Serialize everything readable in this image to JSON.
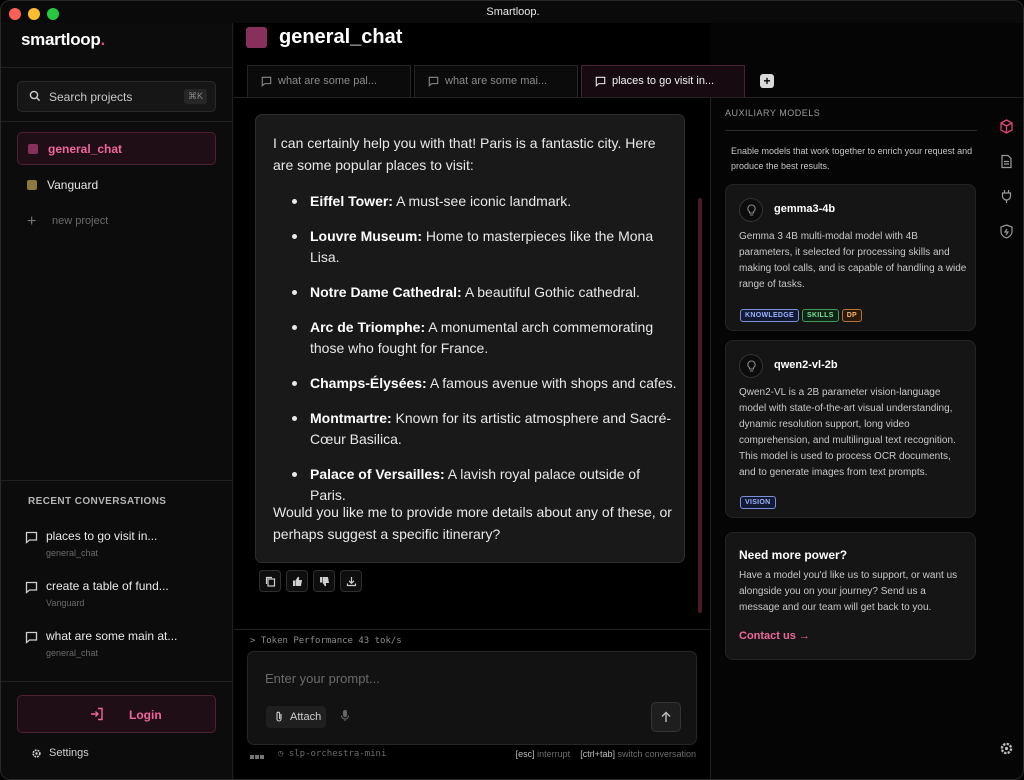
{
  "window": {
    "title": "Smartloop."
  },
  "brand": {
    "name": "smartloop",
    "dot": "."
  },
  "search": {
    "placeholder": "Search projects",
    "shortcut": "⌘K"
  },
  "projects": [
    {
      "label": "general_chat",
      "color": "#86305b",
      "active": true
    },
    {
      "label": "Vanguard",
      "color": "#8a7a3e",
      "active": false
    }
  ],
  "new_project": {
    "label": "new project"
  },
  "recent": {
    "heading": "RECENT CONVERSATIONS",
    "items": [
      {
        "title": "places to go visit in...",
        "project": "general_chat"
      },
      {
        "title": "create a table of fund...",
        "project": "Vanguard"
      },
      {
        "title": "what are some main at...",
        "project": "general_chat"
      }
    ]
  },
  "login": {
    "label": "Login"
  },
  "settings": {
    "label": "Settings"
  },
  "main": {
    "title": "general_chat",
    "tabs": [
      {
        "label": "what are some pal...",
        "active": false
      },
      {
        "label": "what are some mai...",
        "active": false
      },
      {
        "label": "places to go visit in...",
        "active": true
      }
    ]
  },
  "message": {
    "intro": "I can certainly help you with that! Paris is a fantastic city. Here are some popular places to visit:",
    "items": [
      {
        "name": "Eiffel Tower:",
        "desc": " A must-see iconic landmark."
      },
      {
        "name": "Louvre Museum:",
        "desc": " Home to masterpieces like the Mona Lisa."
      },
      {
        "name": "Notre Dame Cathedral:",
        "desc": " A beautiful Gothic cathedral."
      },
      {
        "name": "Arc de Triomphe:",
        "desc": " A monumental arch commemorating those who fought for France."
      },
      {
        "name": "Champs-Élysées:",
        "desc": " A famous avenue with shops and cafes."
      },
      {
        "name": "Montmartre:",
        "desc": " Known for its artistic atmosphere and Sacré-Cœur Basilica."
      },
      {
        "name": "Palace of Versailles:",
        "desc": " A lavish royal palace outside of Paris."
      }
    ],
    "outro": "Would you like me to provide more details about any of these, or perhaps suggest a specific itinerary?"
  },
  "perf": {
    "text": "> Token Performance 43 tok/s"
  },
  "composer": {
    "placeholder": "Enter your prompt...",
    "attach": "Attach"
  },
  "status": {
    "model": "slp-orchestra-mini",
    "esc_key": "[esc]",
    "esc_label": " interrupt",
    "tab_key": "[ctrl+tab]",
    "tab_label": " switch conversation"
  },
  "aux": {
    "heading": "AUXILIARY MODELS",
    "description": "Enable models that work together to enrich your request and produce the best results.",
    "models": [
      {
        "name": "gemma3-4b",
        "description": "Gemma 3 4B multi-modal model with 4B parameters, it selected for processing skills and making tool calls, and is capable of handling a wide range of tasks.",
        "tags": [
          "KNOWLEDGE",
          "SKILLS",
          "DP"
        ]
      },
      {
        "name": "qwen2-vl-2b",
        "description": "Qwen2-VL is a 2B parameter vision-language model with state-of-the-art visual understanding, dynamic resolution support, long video comprehension, and multilingual text recognition. This model is used to process OCR documents, and to generate images from text prompts.",
        "tags": [
          "VISION"
        ]
      }
    ],
    "power": {
      "title": "Need more power?",
      "text": "Have a model you'd like us to support, or want us alongside you on your journey? Send us a message and our team will get back to you.",
      "link": "Contact us →"
    }
  },
  "colors": {
    "accent": "#f0679b",
    "accent_dark": "#86305b"
  }
}
